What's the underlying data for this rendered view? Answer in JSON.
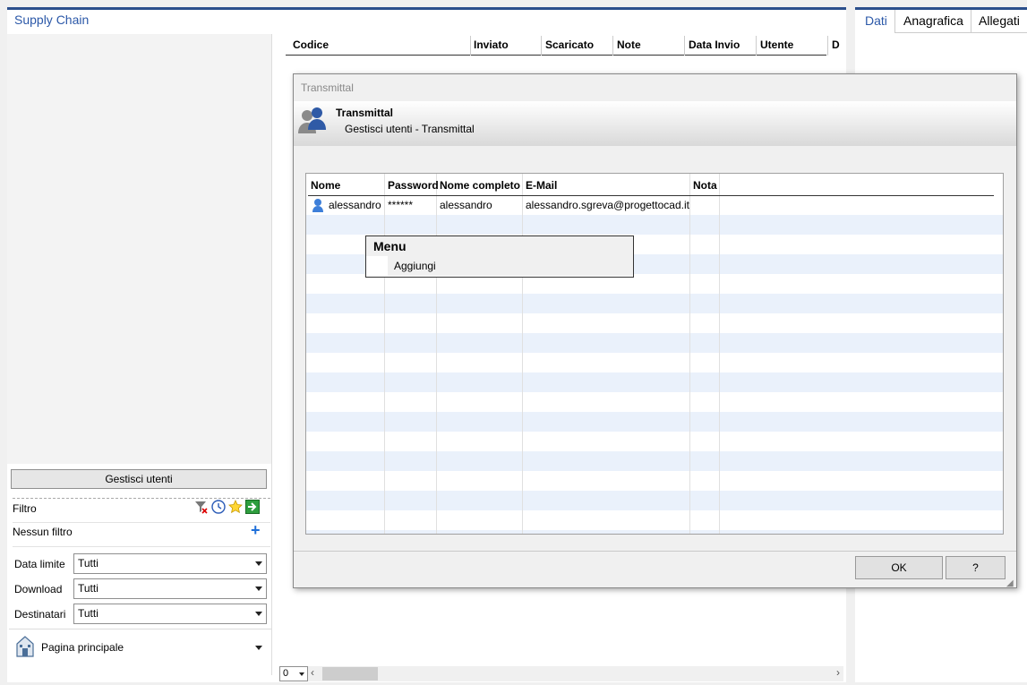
{
  "main": {
    "title": "Supply Chain"
  },
  "left": {
    "manage_button": "Gestisci utenti",
    "filter_label": "Filtro",
    "no_filter_label": "Nessun filtro",
    "filters": [
      {
        "label": "Data limite",
        "value": "Tutti"
      },
      {
        "label": "Download",
        "value": "Tutti"
      },
      {
        "label": "Destinatari",
        "value": "Tutti"
      }
    ],
    "home_label": "Pagina principale"
  },
  "grid": {
    "columns": [
      "Codice",
      "Inviato",
      "Scaricato",
      "Note",
      "Data Invio",
      "Utente",
      "D"
    ]
  },
  "pager": {
    "value": "0"
  },
  "right": {
    "tabs": [
      "Dati",
      "Anagrafica",
      "Allegati"
    ]
  },
  "dialog": {
    "window_title": "Transmittal",
    "header_title": "Transmittal",
    "header_subtitle": "Gestisci utenti - Transmittal",
    "table": {
      "columns": [
        "Nome",
        "Password",
        "Nome completo",
        "E-Mail",
        "Nota"
      ],
      "rows": [
        {
          "nome": "alessandro",
          "password": "******",
          "nome_completo": "alessandro",
          "email": "alessandro.sgreva@progettocad.it",
          "nota": ""
        }
      ]
    },
    "menu": {
      "title": "Menu",
      "item": "Aggiungi"
    },
    "ok_button": "OK",
    "help_button": "?"
  }
}
